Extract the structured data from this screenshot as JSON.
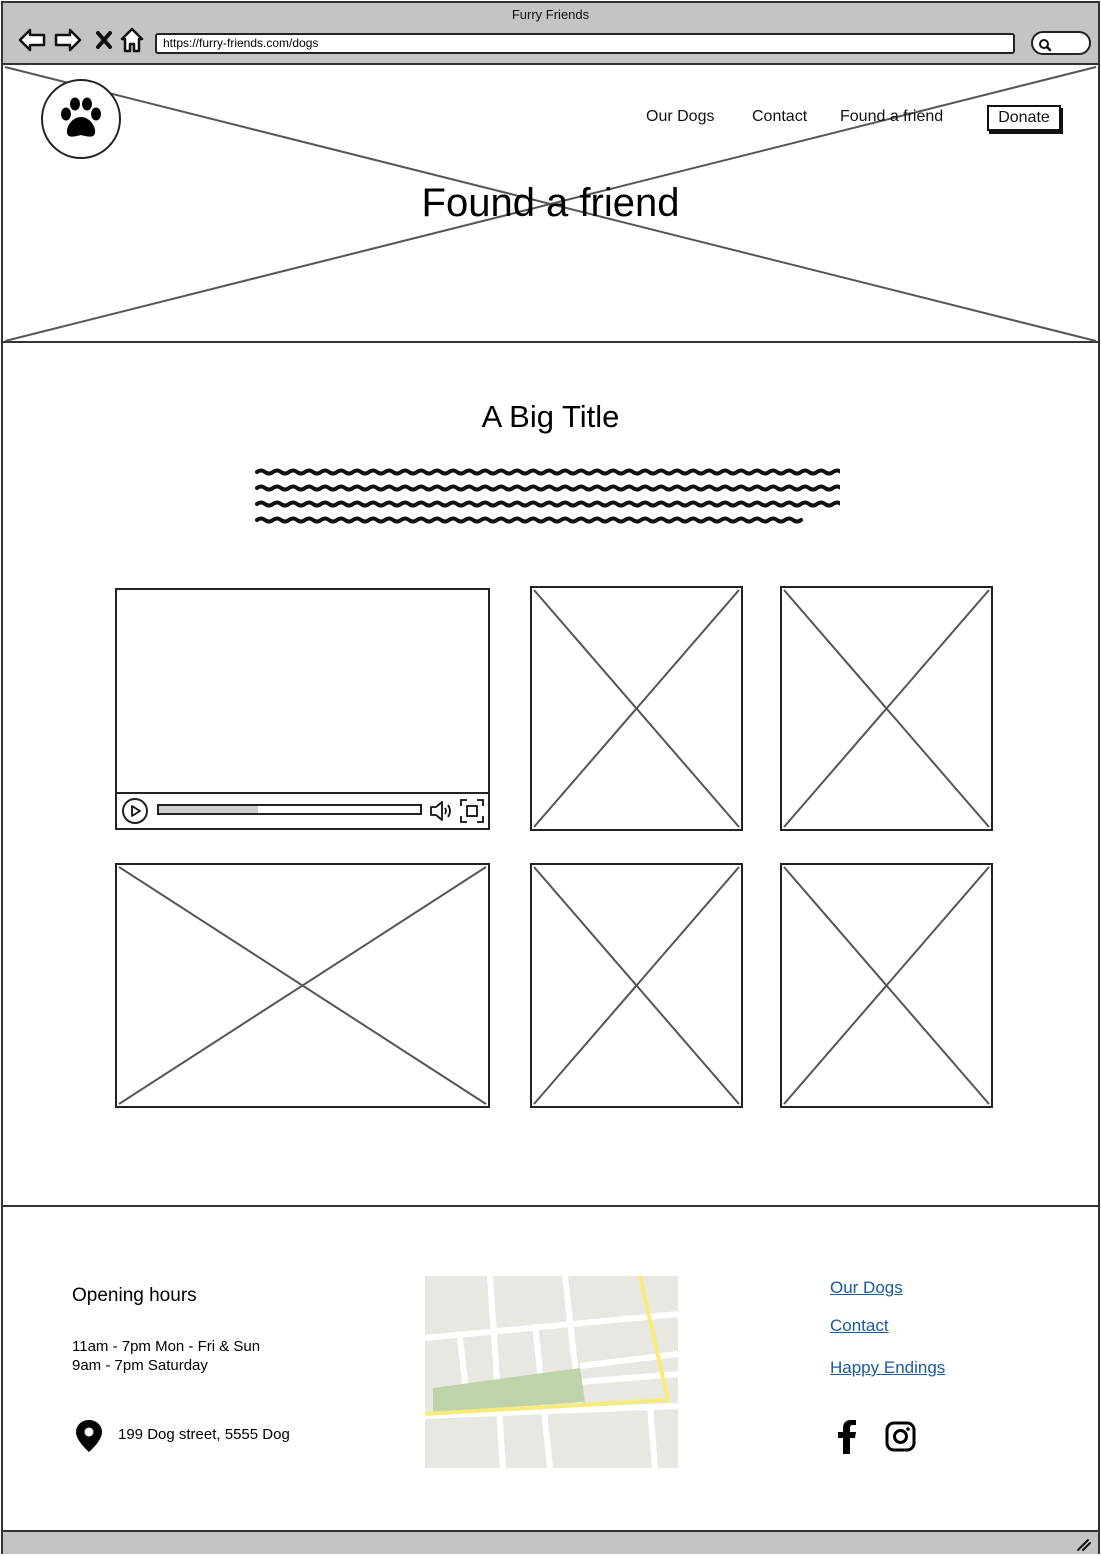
{
  "browser": {
    "title": "Furry Friends",
    "url": "https://furry-friends.com/dogs",
    "icons": [
      "back-arrow-icon",
      "forward-arrow-icon",
      "close-icon",
      "home-icon",
      "search-icon"
    ]
  },
  "header": {
    "nav": [
      "Our Dogs",
      "Contact",
      "Found a friend"
    ],
    "donate_label": "Donate",
    "hero_title": "Found a friend",
    "logo_icon": "paw-icon"
  },
  "main": {
    "title": "A Big Title",
    "video": {
      "progress": 0.38
    }
  },
  "footer": {
    "opening_heading": "Opening hours",
    "hours": [
      "11am - 7pm Mon - Fri & Sun",
      "9am - 7pm Saturday"
    ],
    "address": "199 Dog street,  5555 Dog",
    "links": [
      "Our Dogs",
      "Contact",
      "Happy Endings"
    ],
    "social_icons": [
      "facebook-icon",
      "instagram-icon"
    ],
    "link_color": "#1a5a9a"
  }
}
